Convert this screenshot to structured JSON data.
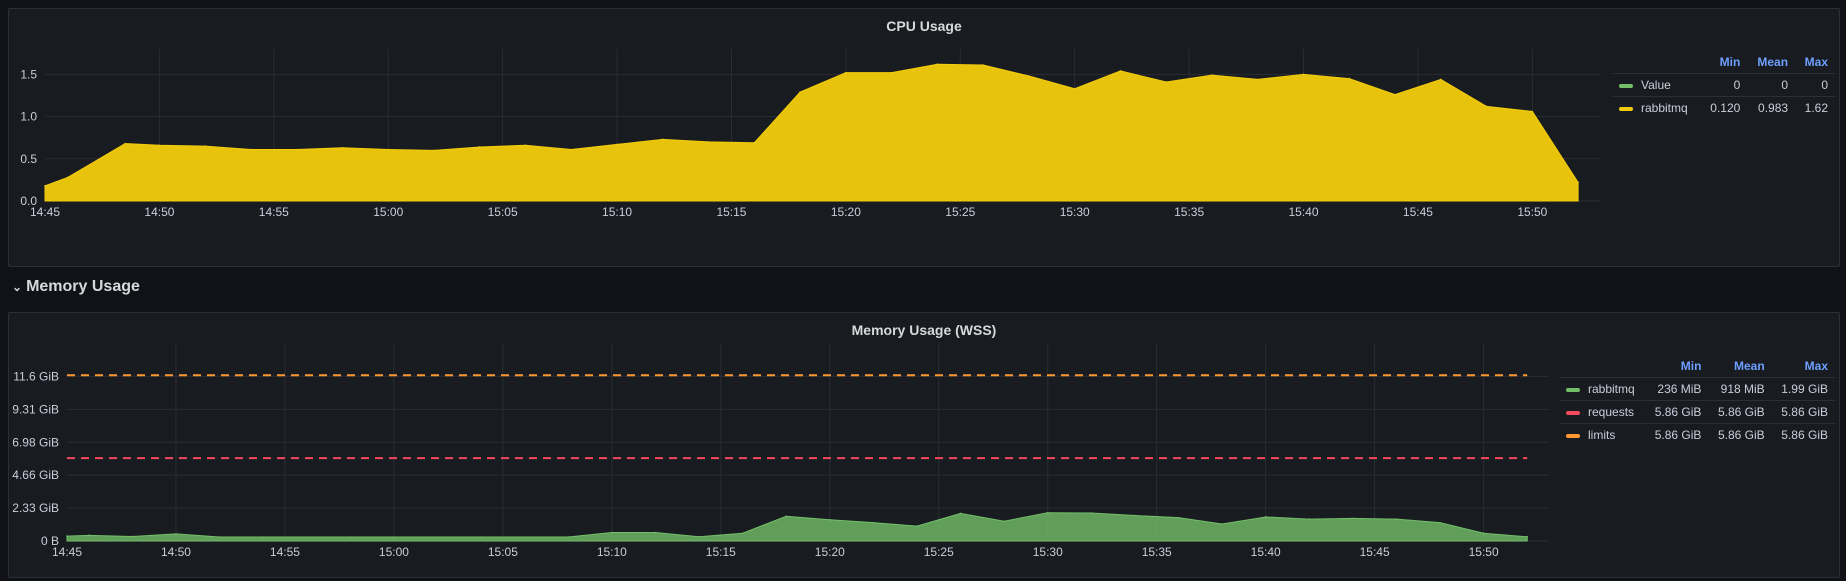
{
  "cpu_panel": {
    "title": "CPU Usage",
    "legend": {
      "headers": [
        "Min",
        "Mean",
        "Max"
      ],
      "rows": [
        {
          "name": "Value",
          "color": "#73bf69",
          "min": "0",
          "mean": "0",
          "max": "0"
        },
        {
          "name": "rabbitmq",
          "color": "#f2cc0c",
          "min": "0.120",
          "mean": "0.983",
          "max": "1.62"
        }
      ]
    }
  },
  "memory_row": {
    "chevron": "chevron-down-icon",
    "title": "Memory Usage"
  },
  "memory_panel": {
    "title": "Memory Usage (WSS)",
    "legend": {
      "headers": [
        "Min",
        "Mean",
        "Max"
      ],
      "rows": [
        {
          "name": "rabbitmq",
          "color": "#73bf69",
          "min": "236 MiB",
          "mean": "918 MiB",
          "max": "1.99 GiB"
        },
        {
          "name": "requests",
          "color": "#f2495c",
          "min": "5.86 GiB",
          "mean": "5.86 GiB",
          "max": "5.86 GiB"
        },
        {
          "name": "limits",
          "color": "#ff9830",
          "min": "5.86 GiB",
          "mean": "5.86 GiB",
          "max": "5.86 GiB"
        }
      ]
    }
  },
  "chart_data": [
    {
      "type": "area",
      "title": "CPU Usage",
      "x_ticks": [
        "14:45",
        "14:50",
        "14:55",
        "15:00",
        "15:05",
        "15:10",
        "15:15",
        "15:20",
        "15:25",
        "15:30",
        "15:35",
        "15:40",
        "15:45",
        "15:50"
      ],
      "y_ticks": [
        "0.0",
        "0.5",
        "1.0",
        "1.5"
      ],
      "ylim": [
        0,
        1.8
      ],
      "xlim": [
        0,
        68
      ],
      "grid": true,
      "legend_position": "right",
      "series": [
        {
          "name": "rabbitmq",
          "color": "#f2cc0c",
          "x": [
            0,
            1,
            3.5,
            5,
            7,
            9,
            11,
            13,
            15,
            17,
            19,
            21,
            23,
            25,
            27,
            29,
            31,
            33,
            35,
            37,
            39,
            41,
            43,
            45,
            47,
            49,
            51,
            53,
            55,
            57,
            59,
            61,
            63,
            65,
            67
          ],
          "y": [
            0.18,
            0.28,
            0.68,
            0.66,
            0.65,
            0.61,
            0.61,
            0.63,
            0.61,
            0.6,
            0.64,
            0.66,
            0.61,
            0.67,
            0.73,
            0.7,
            0.69,
            1.29,
            1.52,
            1.52,
            1.62,
            1.61,
            1.48,
            1.33,
            1.54,
            1.41,
            1.49,
            1.44,
            1.5,
            1.45,
            1.26,
            1.44,
            1.12,
            1.06,
            0.22
          ]
        },
        {
          "name": "Value",
          "color": "#73bf69",
          "x": [
            0,
            67
          ],
          "y": [
            0,
            0
          ]
        }
      ]
    },
    {
      "type": "area",
      "title": "Memory Usage (WSS)",
      "x_ticks": [
        "14:45",
        "14:50",
        "14:55",
        "15:00",
        "15:05",
        "15:10",
        "15:15",
        "15:20",
        "15:25",
        "15:30",
        "15:35",
        "15:40",
        "15:45",
        "15:50"
      ],
      "y_ticks": [
        "0 B",
        "2.33 GiB",
        "4.66 GiB",
        "6.98 GiB",
        "9.31 GiB",
        "11.6 GiB"
      ],
      "ylim": [
        0,
        14
      ],
      "xlim": [
        0,
        68
      ],
      "grid": true,
      "legend_position": "right",
      "series": [
        {
          "name": "rabbitmq",
          "color": "#73bf69",
          "x": [
            0,
            1,
            3,
            5,
            7,
            9,
            11,
            13,
            15,
            17,
            19,
            21,
            23,
            25,
            27,
            29,
            31,
            33,
            35,
            37,
            39,
            41,
            43,
            45,
            47,
            49,
            51,
            53,
            55,
            57,
            59,
            61,
            63,
            65,
            67
          ],
          "y": [
            0.35,
            0.4,
            0.32,
            0.5,
            0.28,
            0.28,
            0.28,
            0.28,
            0.28,
            0.28,
            0.28,
            0.28,
            0.28,
            0.6,
            0.6,
            0.3,
            0.55,
            1.75,
            1.5,
            1.3,
            1.05,
            1.95,
            1.4,
            2.0,
            1.98,
            1.8,
            1.65,
            1.2,
            1.7,
            1.55,
            1.6,
            1.55,
            1.3,
            0.55,
            0.3
          ]
        },
        {
          "name": "requests",
          "color": "#f2495c",
          "dashed": true,
          "x": [
            0,
            67
          ],
          "y": [
            5.86,
            5.86
          ]
        },
        {
          "name": "limits",
          "color": "#ff9830",
          "dashed": true,
          "x": [
            0,
            67
          ],
          "y": [
            11.72,
            11.72
          ]
        }
      ]
    }
  ]
}
